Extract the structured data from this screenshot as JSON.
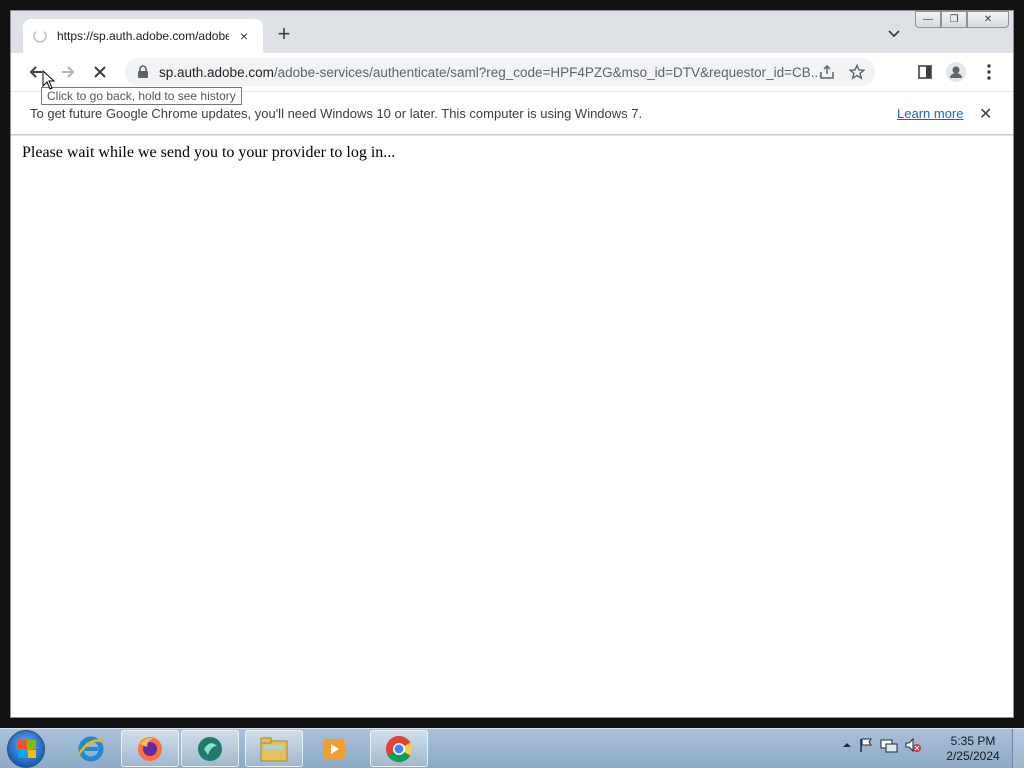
{
  "tab": {
    "title": "https://sp.auth.adobe.com/adobe-services/authenticate/saml",
    "close": "×"
  },
  "newtab": "+",
  "window_controls": {
    "minimize": "—",
    "restore": "❐",
    "close": "✕"
  },
  "address": {
    "host": "sp.auth.adobe.com",
    "path": "/adobe-services/authenticate/saml?reg_code=HPF4PZG&mso_id=DTV&requestor_id=CB..."
  },
  "tooltip": "Click to go back, hold to see history",
  "infobar": {
    "message": "To get future Google Chrome updates, you'll need Windows 10 or later. This computer is using Windows 7.",
    "link": "Learn more",
    "close": "✕"
  },
  "page": {
    "body_text": "Please wait while we send you to your provider to log in..."
  },
  "taskbar": {
    "time": "5:35 PM",
    "date": "2/25/2024",
    "items": [
      "internet-explorer",
      "firefox",
      "media-app",
      "file-explorer",
      "media-player",
      "chrome"
    ]
  },
  "colors": {
    "chrome_frame": "#dee1e6",
    "link": "#1a66c6",
    "taskbar": "#a9c1d8"
  }
}
